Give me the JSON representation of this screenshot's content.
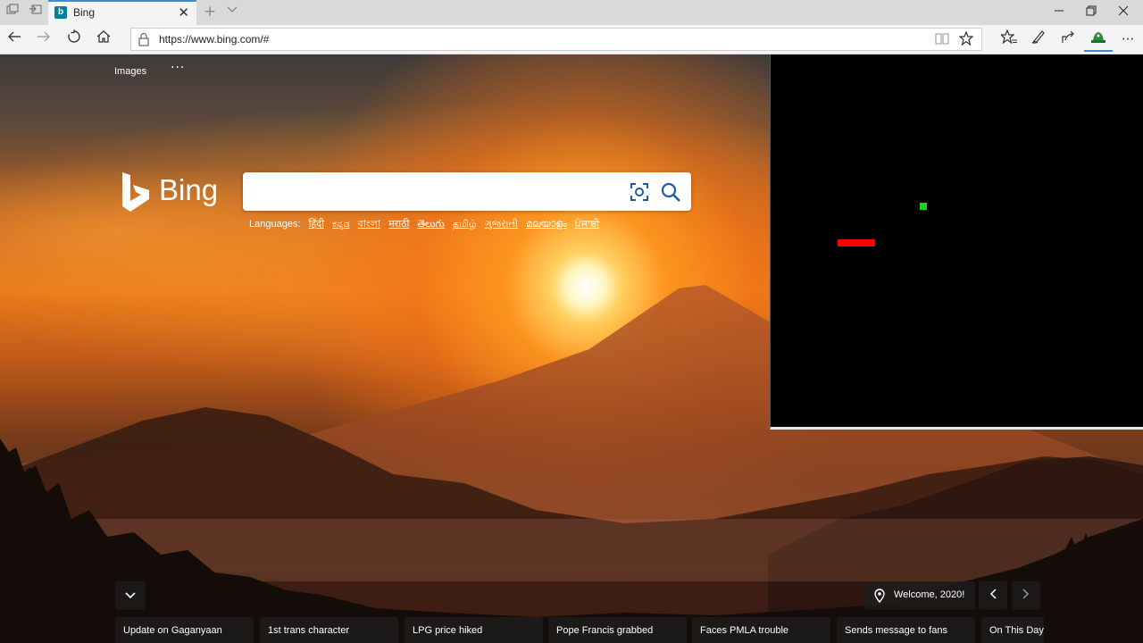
{
  "tab": {
    "title": "Bing",
    "favicon_letter": "b"
  },
  "address": {
    "url": "https://www.bing.com/#"
  },
  "topnav": {
    "images_label": "Images",
    "more_label": "···"
  },
  "logo": {
    "text": "Bing"
  },
  "search": {
    "value": "",
    "placeholder": ""
  },
  "languages": {
    "label": "Languages:",
    "items": [
      "हिंदी",
      "ಕನ್ನಡ",
      "বাংলা",
      "मराठी",
      "తెలుగు",
      "தமிழ்",
      "ગુજરાતી",
      "മലയാളം",
      "ਪੰਜਾਬੀ"
    ]
  },
  "location": {
    "label": "Welcome, 2020!"
  },
  "news": [
    "Update on Gaganyaan",
    "1st trans character",
    "LPG price hiked",
    "Pope Francis grabbed",
    "Faces PMLA trouble",
    "Sends message to fans",
    "On This Day:"
  ],
  "colors": {
    "tab_accent": "#3c8bd8",
    "bing_favicon": "#00809d",
    "paddle": "#ff0000",
    "ball": "#16d616",
    "overlay_background": "#000000"
  },
  "icons": {
    "titlebar": [
      "tab-preview-icon",
      "set-aside-tabs-icon"
    ],
    "navigation": [
      "back-arrow-icon",
      "forward-arrow-icon",
      "refresh-icon",
      "home-icon"
    ],
    "address": [
      "lock-icon",
      "reading-view-icon",
      "favorite-star-icon"
    ],
    "toolbar": [
      "favorites-hub-icon",
      "pen-icon",
      "share-icon",
      "extension-icon",
      "more-icon"
    ],
    "search": [
      "visual-search-icon",
      "search-icon"
    ],
    "page": [
      "chevron-down-icon",
      "location-pin-icon",
      "chevron-left-icon",
      "chevron-right-icon"
    ]
  }
}
